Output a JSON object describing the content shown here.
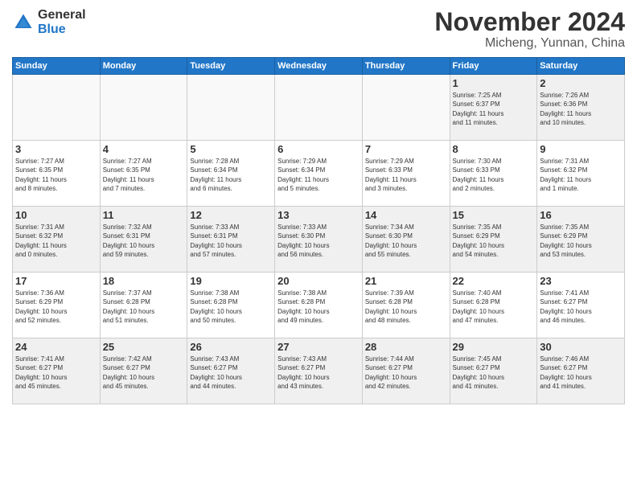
{
  "logo": {
    "general": "General",
    "blue": "Blue"
  },
  "title": "November 2024",
  "location": "Micheng, Yunnan, China",
  "headers": [
    "Sunday",
    "Monday",
    "Tuesday",
    "Wednesday",
    "Thursday",
    "Friday",
    "Saturday"
  ],
  "weeks": [
    [
      {
        "day": "",
        "info": "",
        "empty": true
      },
      {
        "day": "",
        "info": "",
        "empty": true
      },
      {
        "day": "",
        "info": "",
        "empty": true
      },
      {
        "day": "",
        "info": "",
        "empty": true
      },
      {
        "day": "",
        "info": "",
        "empty": true
      },
      {
        "day": "1",
        "info": "Sunrise: 7:25 AM\nSunset: 6:37 PM\nDaylight: 11 hours\nand 11 minutes."
      },
      {
        "day": "2",
        "info": "Sunrise: 7:26 AM\nSunset: 6:36 PM\nDaylight: 11 hours\nand 10 minutes."
      }
    ],
    [
      {
        "day": "3",
        "info": "Sunrise: 7:27 AM\nSunset: 6:35 PM\nDaylight: 11 hours\nand 8 minutes."
      },
      {
        "day": "4",
        "info": "Sunrise: 7:27 AM\nSunset: 6:35 PM\nDaylight: 11 hours\nand 7 minutes."
      },
      {
        "day": "5",
        "info": "Sunrise: 7:28 AM\nSunset: 6:34 PM\nDaylight: 11 hours\nand 6 minutes."
      },
      {
        "day": "6",
        "info": "Sunrise: 7:29 AM\nSunset: 6:34 PM\nDaylight: 11 hours\nand 5 minutes."
      },
      {
        "day": "7",
        "info": "Sunrise: 7:29 AM\nSunset: 6:33 PM\nDaylight: 11 hours\nand 3 minutes."
      },
      {
        "day": "8",
        "info": "Sunrise: 7:30 AM\nSunset: 6:33 PM\nDaylight: 11 hours\nand 2 minutes."
      },
      {
        "day": "9",
        "info": "Sunrise: 7:31 AM\nSunset: 6:32 PM\nDaylight: 11 hours\nand 1 minute."
      }
    ],
    [
      {
        "day": "10",
        "info": "Sunrise: 7:31 AM\nSunset: 6:32 PM\nDaylight: 11 hours\nand 0 minutes."
      },
      {
        "day": "11",
        "info": "Sunrise: 7:32 AM\nSunset: 6:31 PM\nDaylight: 10 hours\nand 59 minutes."
      },
      {
        "day": "12",
        "info": "Sunrise: 7:33 AM\nSunset: 6:31 PM\nDaylight: 10 hours\nand 57 minutes."
      },
      {
        "day": "13",
        "info": "Sunrise: 7:33 AM\nSunset: 6:30 PM\nDaylight: 10 hours\nand 56 minutes."
      },
      {
        "day": "14",
        "info": "Sunrise: 7:34 AM\nSunset: 6:30 PM\nDaylight: 10 hours\nand 55 minutes."
      },
      {
        "day": "15",
        "info": "Sunrise: 7:35 AM\nSunset: 6:29 PM\nDaylight: 10 hours\nand 54 minutes."
      },
      {
        "day": "16",
        "info": "Sunrise: 7:35 AM\nSunset: 6:29 PM\nDaylight: 10 hours\nand 53 minutes."
      }
    ],
    [
      {
        "day": "17",
        "info": "Sunrise: 7:36 AM\nSunset: 6:29 PM\nDaylight: 10 hours\nand 52 minutes."
      },
      {
        "day": "18",
        "info": "Sunrise: 7:37 AM\nSunset: 6:28 PM\nDaylight: 10 hours\nand 51 minutes."
      },
      {
        "day": "19",
        "info": "Sunrise: 7:38 AM\nSunset: 6:28 PM\nDaylight: 10 hours\nand 50 minutes."
      },
      {
        "day": "20",
        "info": "Sunrise: 7:38 AM\nSunset: 6:28 PM\nDaylight: 10 hours\nand 49 minutes."
      },
      {
        "day": "21",
        "info": "Sunrise: 7:39 AM\nSunset: 6:28 PM\nDaylight: 10 hours\nand 48 minutes."
      },
      {
        "day": "22",
        "info": "Sunrise: 7:40 AM\nSunset: 6:28 PM\nDaylight: 10 hours\nand 47 minutes."
      },
      {
        "day": "23",
        "info": "Sunrise: 7:41 AM\nSunset: 6:27 PM\nDaylight: 10 hours\nand 46 minutes."
      }
    ],
    [
      {
        "day": "24",
        "info": "Sunrise: 7:41 AM\nSunset: 6:27 PM\nDaylight: 10 hours\nand 45 minutes."
      },
      {
        "day": "25",
        "info": "Sunrise: 7:42 AM\nSunset: 6:27 PM\nDaylight: 10 hours\nand 45 minutes."
      },
      {
        "day": "26",
        "info": "Sunrise: 7:43 AM\nSunset: 6:27 PM\nDaylight: 10 hours\nand 44 minutes."
      },
      {
        "day": "27",
        "info": "Sunrise: 7:43 AM\nSunset: 6:27 PM\nDaylight: 10 hours\nand 43 minutes."
      },
      {
        "day": "28",
        "info": "Sunrise: 7:44 AM\nSunset: 6:27 PM\nDaylight: 10 hours\nand 42 minutes."
      },
      {
        "day": "29",
        "info": "Sunrise: 7:45 AM\nSunset: 6:27 PM\nDaylight: 10 hours\nand 41 minutes."
      },
      {
        "day": "30",
        "info": "Sunrise: 7:46 AM\nSunset: 6:27 PM\nDaylight: 10 hours\nand 41 minutes."
      }
    ]
  ]
}
